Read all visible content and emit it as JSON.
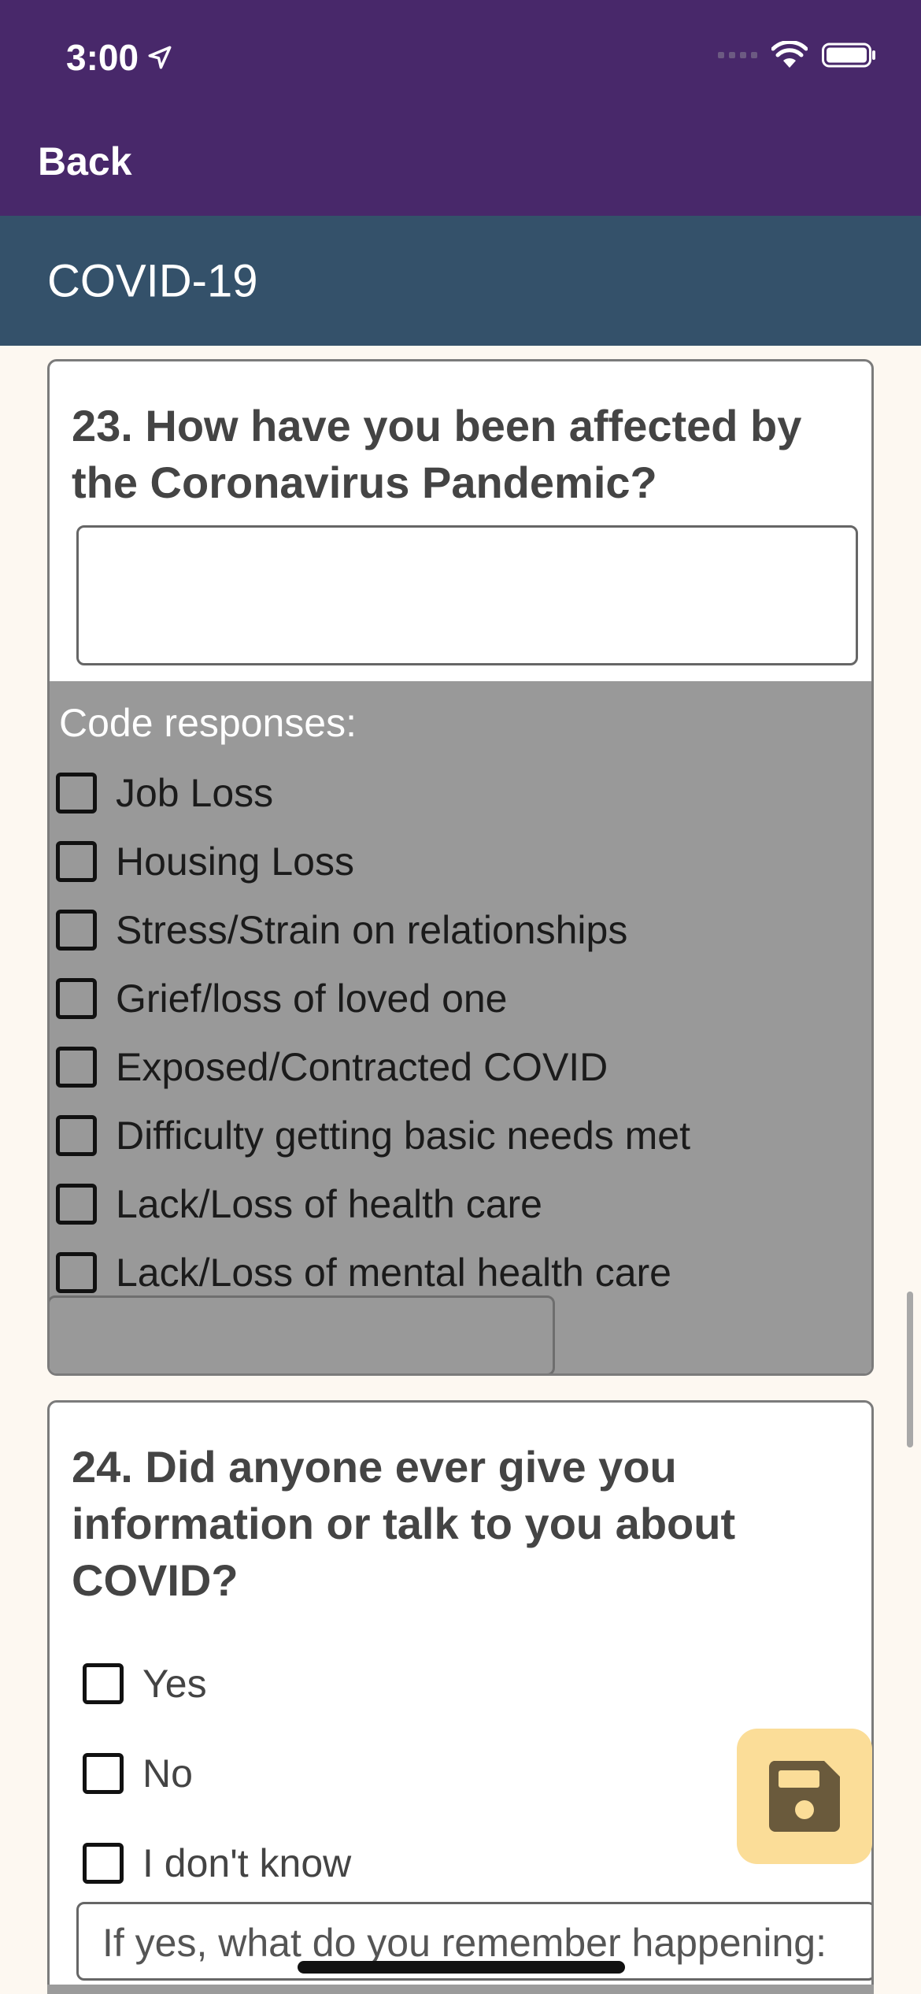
{
  "status_bar": {
    "time": "3:00"
  },
  "nav": {
    "back_label": "Back"
  },
  "section": {
    "title": "COVID-19"
  },
  "q23": {
    "title": "23. How have you been affected by the Coronavirus Pandemic?",
    "answer_value": "",
    "code_label": "Code responses:",
    "codes": [
      "Job Loss",
      "Housing Loss",
      "Stress/Strain on relationships",
      "Grief/loss of loved one",
      "Exposed/Contracted COVID",
      "Difficulty getting basic needs met",
      "Lack/Loss of health care",
      "Lack/Loss of mental health care"
    ]
  },
  "q24": {
    "title": "24. Did anyone ever give you information or talk to you about COVID?",
    "options": [
      "Yes",
      "No",
      "I don't know"
    ],
    "followup_placeholder": "If yes, what do you remember happening:"
  },
  "colors": {
    "nav_bg": "#48286a",
    "section_bg": "#34516a",
    "code_area_bg": "#999999",
    "fab_bg": "#fbdd98",
    "page_bg": "#fdf8f1"
  },
  "icons": {
    "save": "floppy-disk-icon",
    "location": "location-arrow-icon"
  }
}
